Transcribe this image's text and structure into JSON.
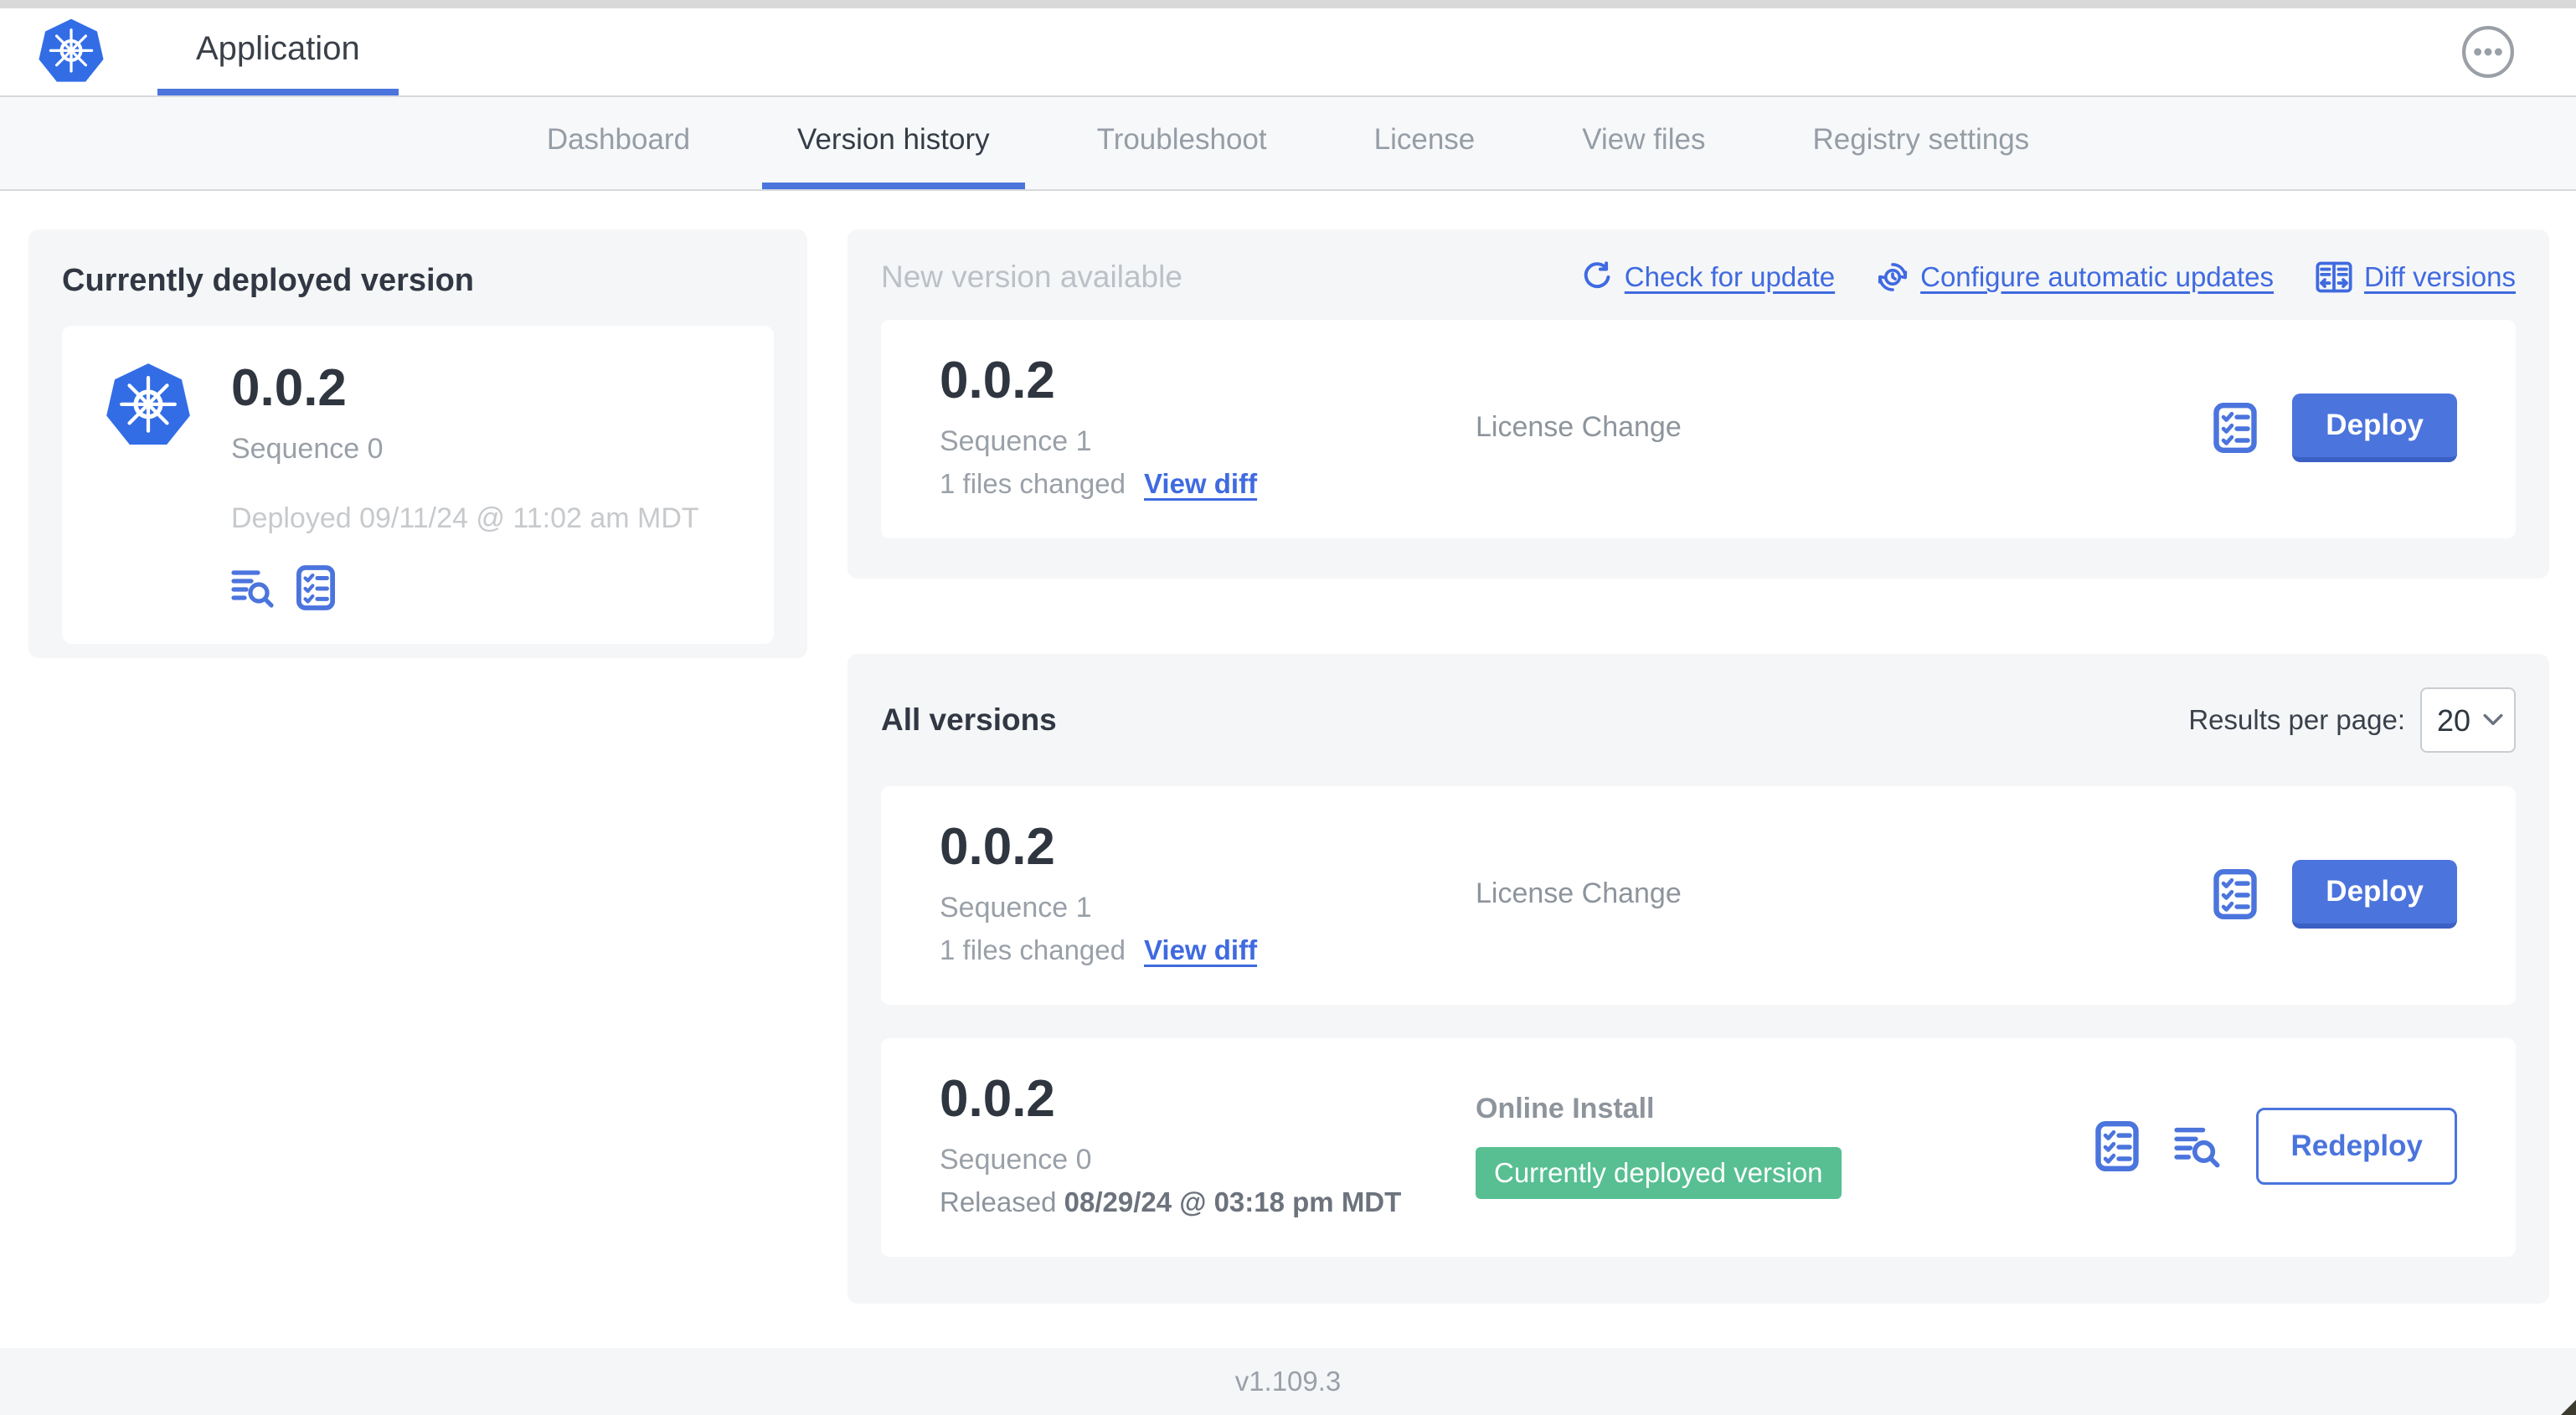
{
  "header": {
    "title": "Application"
  },
  "nav": {
    "tabs": [
      {
        "label": "Dashboard",
        "active": false
      },
      {
        "label": "Version history",
        "active": true
      },
      {
        "label": "Troubleshoot",
        "active": false
      },
      {
        "label": "License",
        "active": false
      },
      {
        "label": "View files",
        "active": false
      },
      {
        "label": "Registry settings",
        "active": false
      }
    ]
  },
  "current_version": {
    "section_title": "Currently deployed version",
    "version": "0.0.2",
    "sequence": "Sequence 0",
    "deployed": "Deployed 09/11/24 @ 11:02 am MDT",
    "icons": [
      "log-search-icon",
      "checklist-icon"
    ]
  },
  "new_version": {
    "section_title": "New version available",
    "actions": [
      {
        "label": "Check for update",
        "icon": "refresh-icon"
      },
      {
        "label": "Configure automatic updates",
        "icon": "clock-refresh-icon"
      },
      {
        "label": "Diff versions",
        "icon": "split-diff-icon"
      }
    ],
    "card": {
      "version": "0.0.2",
      "sequence": "Sequence 1",
      "files_changed": "1 files changed",
      "view_diff_label": "View diff",
      "source": "License Change",
      "deploy_label": "Deploy"
    }
  },
  "all_versions": {
    "section_title": "All versions",
    "results_per_page_label": "Results per page:",
    "results_per_page_value": "20",
    "rows": [
      {
        "version": "0.0.2",
        "sequence": "Sequence 1",
        "files_changed": "1 files changed",
        "view_diff_label": "View diff",
        "source": "License Change",
        "action_label": "Deploy"
      },
      {
        "version": "0.0.2",
        "sequence": "Sequence 0",
        "released_label": "Released",
        "released_value": "08/29/24 @ 03:18 pm MDT",
        "source": "Online Install",
        "badge": "Currently deployed version",
        "action_label": "Redeploy"
      }
    ]
  },
  "footer": {
    "version": "v1.109.3"
  },
  "colors": {
    "accent": "#4B74DD",
    "link": "#3F6AE0",
    "badge_green": "#57BF92",
    "k8s_blue": "#326DE6"
  }
}
